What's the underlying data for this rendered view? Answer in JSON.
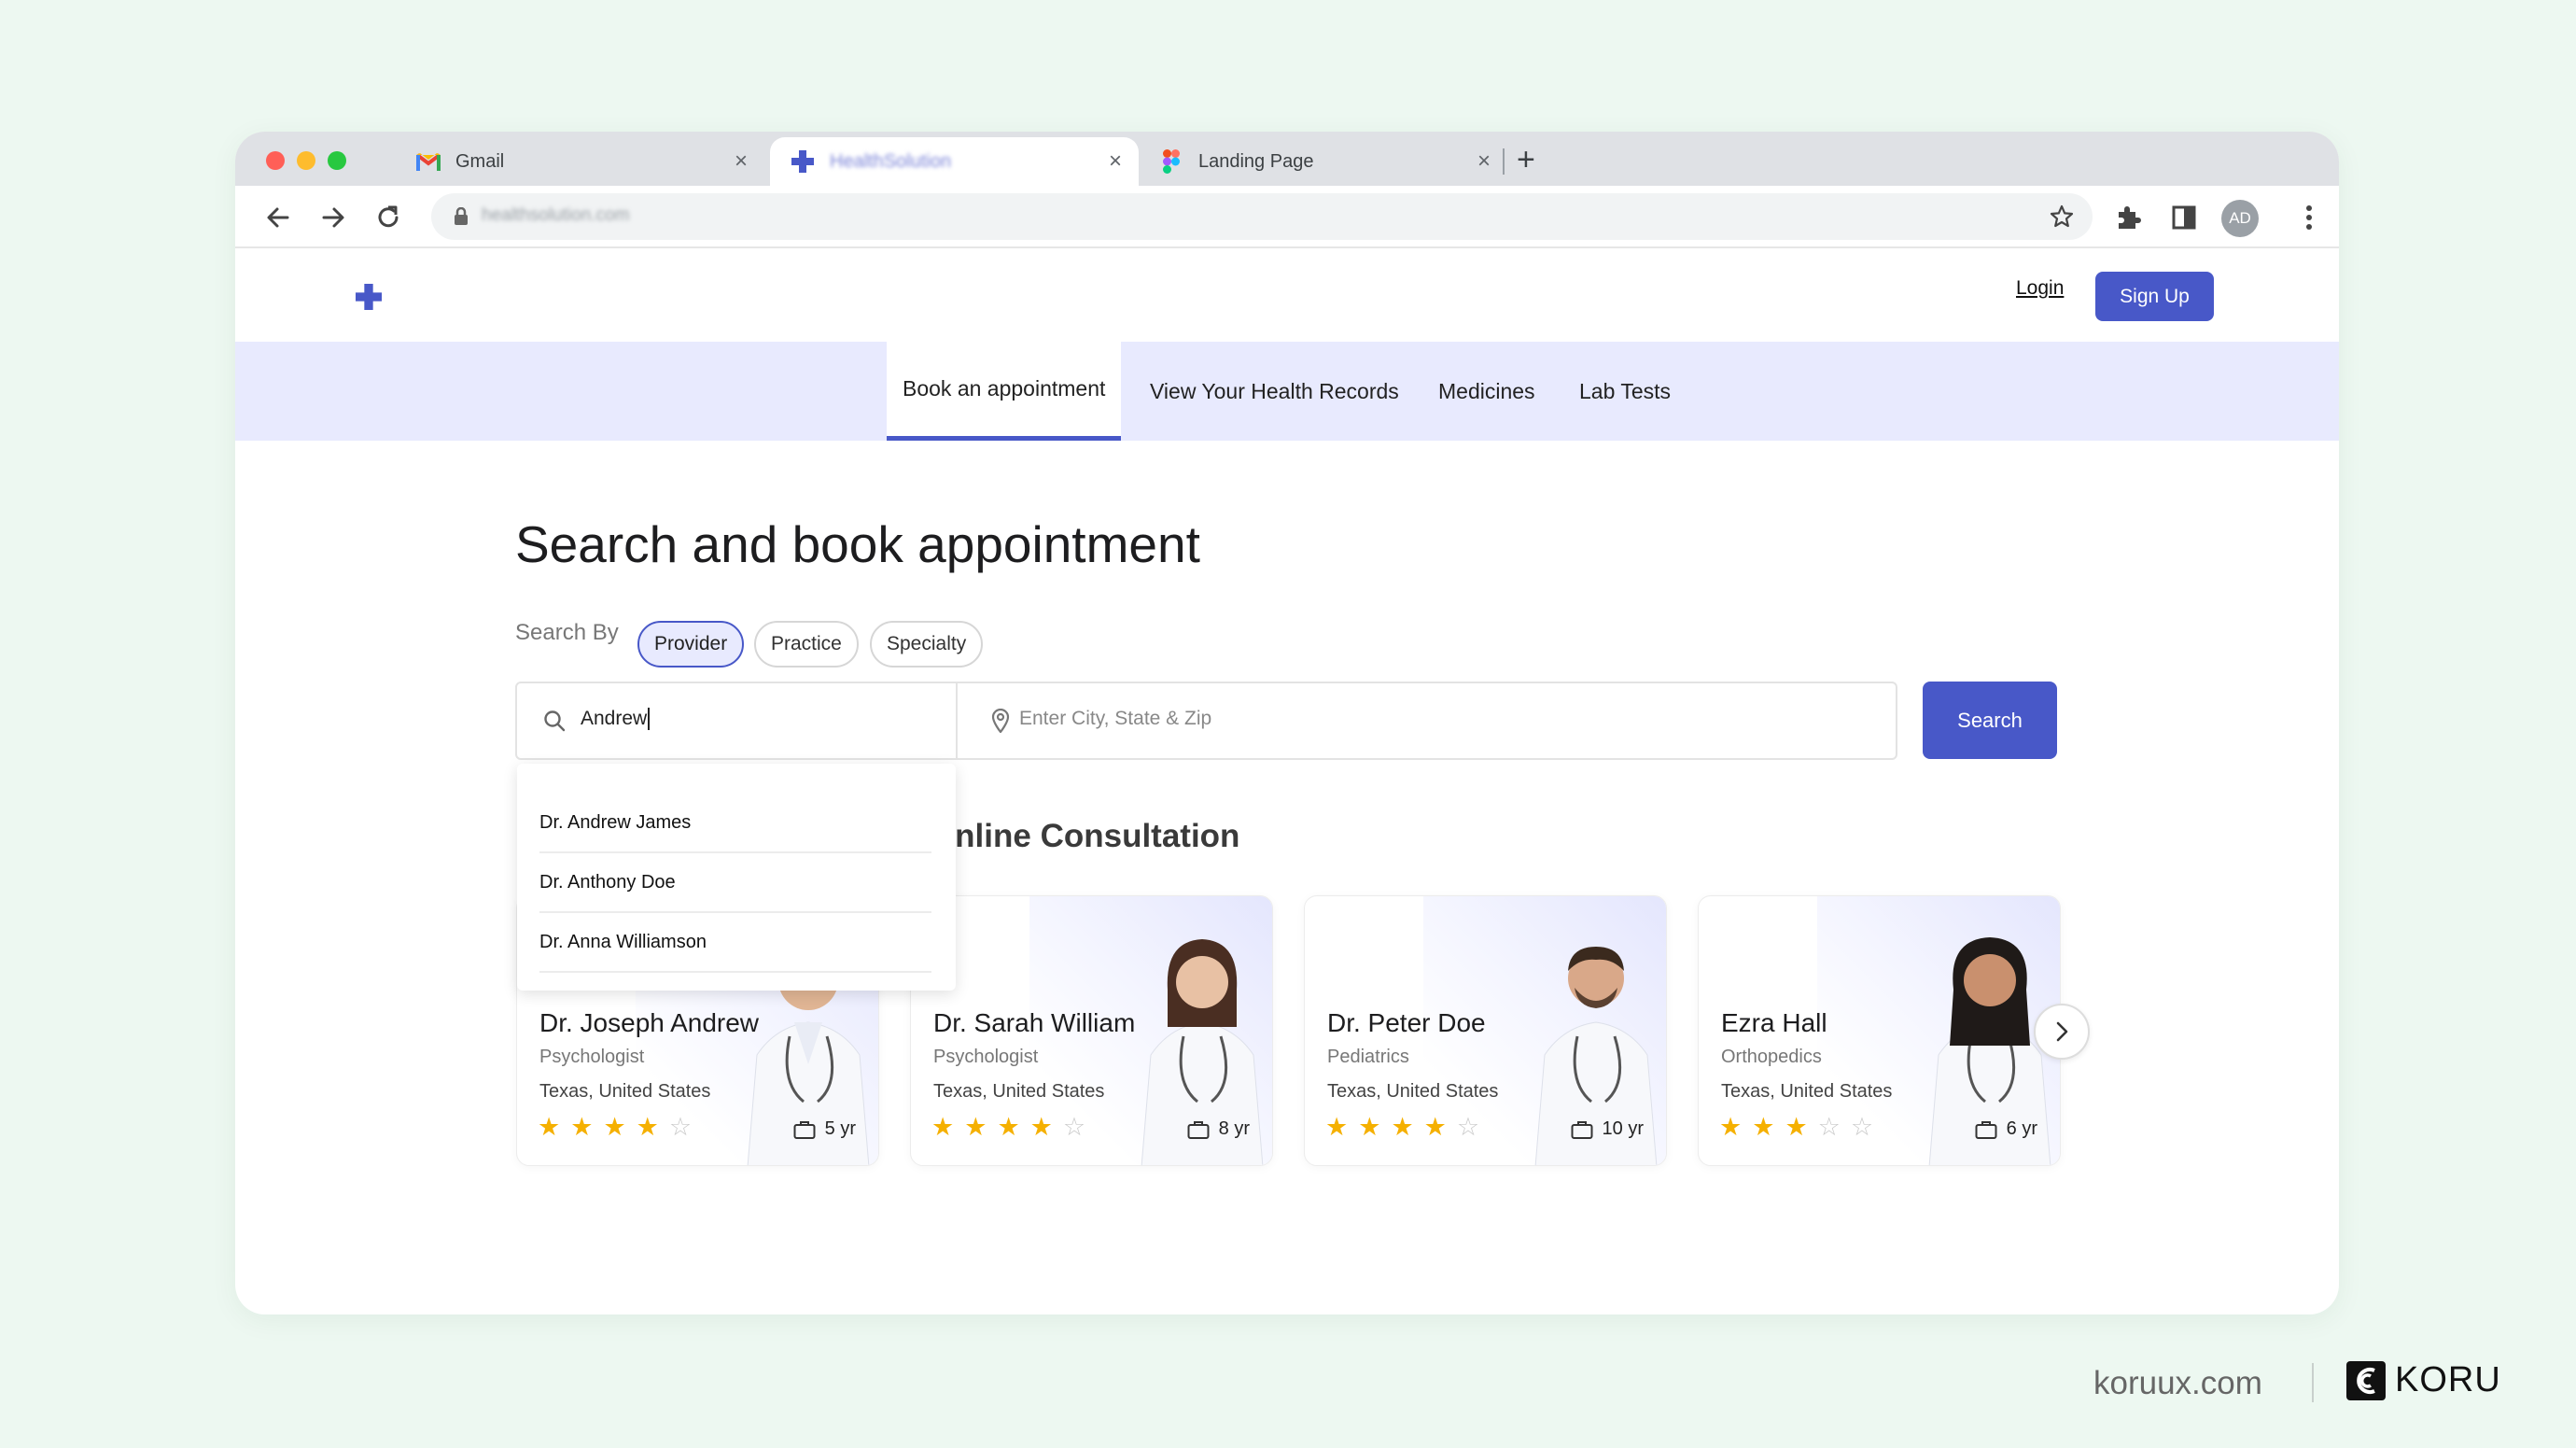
{
  "browser": {
    "tabs": [
      {
        "label": "Gmail",
        "icon": "gmail-icon",
        "active": false
      },
      {
        "label": "HealthSolution",
        "icon": "plus-icon",
        "active": true
      },
      {
        "label": "Landing Page",
        "icon": "figma-icon",
        "active": false
      }
    ],
    "url": "healthsolution.com",
    "profile_initials": "AD",
    "colors": {
      "close": "#ff5f57",
      "minimize": "#febc2e",
      "maximize": "#28c840"
    }
  },
  "header": {
    "login": "Login",
    "signup": "Sign Up",
    "brand_color": "#4858c8"
  },
  "nav": {
    "tabs": [
      {
        "label": "Book an appointment",
        "active": true
      },
      {
        "label": "View Your Health Records",
        "active": false
      },
      {
        "label": "Medicines",
        "active": false
      },
      {
        "label": "Lab Tests",
        "active": false
      }
    ]
  },
  "main": {
    "title": "Search and book appointment",
    "search_by_label": "Search By",
    "filters": [
      {
        "label": "Provider",
        "selected": true
      },
      {
        "label": "Practice",
        "selected": false
      },
      {
        "label": "Specialty",
        "selected": false
      }
    ],
    "search": {
      "value": "Andrew",
      "location_placeholder": "Enter City, State & Zip",
      "button": "Search"
    },
    "suggestions": [
      "Dr. Andrew James",
      "Dr. Anthony Doe",
      "Dr. Anna Williamson"
    ],
    "section_heading": "and Online Consultation",
    "doctors": [
      {
        "name": "Dr. Joseph Andrew",
        "specialty": "Psychologist",
        "location": "Texas, United States",
        "rating": 4,
        "experience": "5 yr"
      },
      {
        "name": "Dr. Sarah William",
        "specialty": "Psychologist",
        "location": "Texas, United States",
        "rating": 4,
        "experience": "8 yr"
      },
      {
        "name": "Dr. Peter Doe",
        "specialty": "Pediatrics",
        "location": "Texas, United States",
        "rating": 4,
        "experience": "10 yr"
      },
      {
        "name": "Ezra Hall",
        "specialty": "Orthopedics",
        "location": "Texas, United States",
        "rating": 3,
        "experience": "6 yr"
      }
    ]
  },
  "footer": {
    "domain": "koruux.com",
    "brand": "KORU"
  }
}
